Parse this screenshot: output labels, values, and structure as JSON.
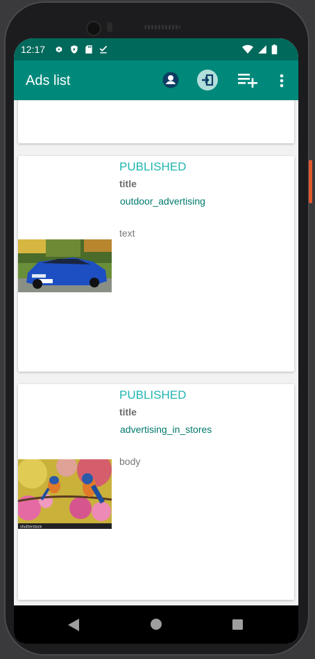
{
  "status_bar": {
    "time": "12:17",
    "left_icons": [
      "gear-icon",
      "play-protect-icon",
      "sd-card-icon",
      "download-done-icon"
    ],
    "right_icons": [
      "wifi-icon",
      "signal-icon",
      "battery-icon"
    ]
  },
  "app_bar": {
    "title": "Ads list",
    "actions": [
      "account-icon",
      "login-icon",
      "playlist-add-icon",
      "more-vert-icon"
    ],
    "color": "#00897b",
    "status_color": "#00695c"
  },
  "ads": [
    {
      "status": "PUBLISHED",
      "title": "title",
      "type": "outdoor_advertising",
      "text": "text",
      "image": "blue-car-image"
    },
    {
      "status": "PUBLISHED",
      "title": "title",
      "type": "advertising_in_stores",
      "text": "body",
      "image": "birds-on-blossoms-image",
      "image_watermark": "shutterstock"
    }
  ],
  "nav_bar": [
    "back-icon",
    "home-icon",
    "recents-icon"
  ]
}
